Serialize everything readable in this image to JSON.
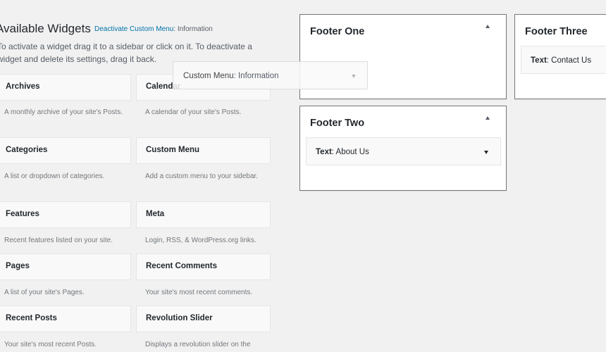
{
  "available": {
    "title": "Available Widgets",
    "deactivate_link": "Deactivate Custom Menu",
    "deactivate_suffix": ": Information",
    "description": "To activate a widget drag it to a sidebar or click on it. To deactivate a widget and delete its settings, drag it back."
  },
  "widgets": [
    {
      "title": "Archives",
      "desc": "A monthly archive of your site's Posts."
    },
    {
      "title": "Calendar",
      "desc": "A calendar of your site's Posts."
    },
    {
      "title": "Categories",
      "desc": "A list or dropdown of categories."
    },
    {
      "title": "Custom Menu",
      "desc": "Add a custom menu to your sidebar."
    },
    {
      "title": "Features",
      "desc": "Recent features listed on your site."
    },
    {
      "title": "Meta",
      "desc": "Login, RSS, & WordPress.org links."
    },
    {
      "title": "Pages",
      "desc": "A list of your site's Pages."
    },
    {
      "title": "Recent Comments",
      "desc": "Your site's most recent comments."
    },
    {
      "title": "Recent Posts",
      "desc": "Your site's most recent Posts."
    },
    {
      "title": "Revolution Slider",
      "desc": "Displays a revolution slider on the"
    }
  ],
  "sidebars": {
    "footer_one": {
      "title": "Footer One"
    },
    "footer_two": {
      "title": "Footer Two",
      "widget_type": "Text",
      "widget_name": ": About Us"
    },
    "footer_three": {
      "title": "Footer Three",
      "widget_type": "Text",
      "widget_name": ": Contact Us"
    }
  },
  "dragging": {
    "type": "Custom Menu",
    "name": ": Information"
  },
  "colors": {
    "link": "#0073aa",
    "border_active": "#72777c",
    "tile_bg": "#f9f9f9"
  }
}
